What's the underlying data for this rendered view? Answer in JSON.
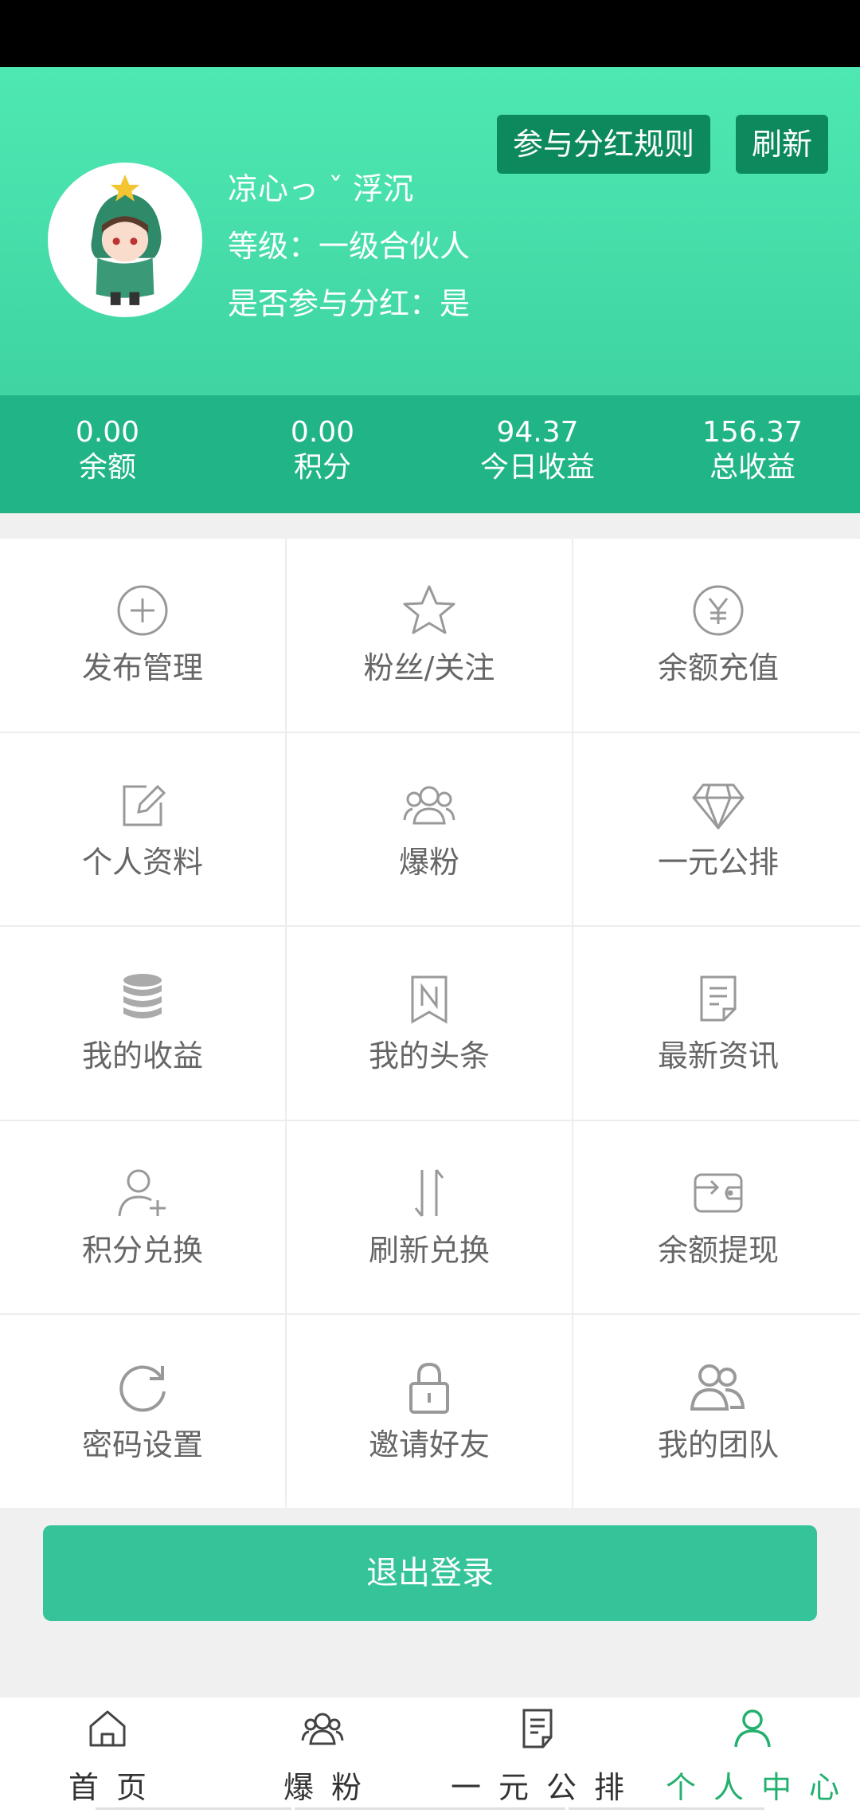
{
  "header": {
    "username": "凉心っ ˇ 浮沉",
    "level": "等级：一级合伙人",
    "dividend": "是否参与分红：是",
    "rules_button": "参与分红规则",
    "refresh_button": "刷新"
  },
  "stats": [
    {
      "value": "0.00",
      "label": "余额"
    },
    {
      "value": "0.00",
      "label": "积分"
    },
    {
      "value": "94.37",
      "label": "今日收益"
    },
    {
      "value": "156.37",
      "label": "总收益"
    }
  ],
  "menu": [
    {
      "label": "发布管理",
      "icon": "plus-circle-icon"
    },
    {
      "label": "粉丝/关注",
      "icon": "star-icon"
    },
    {
      "label": "余额充值",
      "icon": "yen-circle-icon"
    },
    {
      "label": "个人资料",
      "icon": "edit-icon"
    },
    {
      "label": "爆粉",
      "icon": "users-icon"
    },
    {
      "label": "一元公排",
      "icon": "diamond-icon"
    },
    {
      "label": "我的收益",
      "icon": "coins-icon"
    },
    {
      "label": "我的头条",
      "icon": "bookmark-n-icon"
    },
    {
      "label": "最新资讯",
      "icon": "document-icon"
    },
    {
      "label": "积分兑换",
      "icon": "user-plus-icon"
    },
    {
      "label": "刷新兑换",
      "icon": "swap-arrows-icon"
    },
    {
      "label": "余额提现",
      "icon": "wallet-icon"
    },
    {
      "label": "密码设置",
      "icon": "refresh-icon"
    },
    {
      "label": "邀请好友",
      "icon": "lock-icon"
    },
    {
      "label": "我的团队",
      "icon": "team-icon"
    }
  ],
  "logout_button": "退出登录",
  "tabbar": [
    {
      "label": "首页",
      "icon": "home-icon",
      "active": false
    },
    {
      "label": "爆粉",
      "icon": "users-icon",
      "active": false
    },
    {
      "label": "一元公排",
      "icon": "document-icon",
      "active": false
    },
    {
      "label": "个人中心",
      "icon": "user-icon",
      "active": true
    }
  ],
  "colors": {
    "header_top": "#4ee8b2",
    "stats_bg": "#20b487",
    "button_dark": "#0d8a5d",
    "logout_bg": "#35c39a",
    "active_tab": "#23b06f",
    "icon_gray": "#999999"
  }
}
